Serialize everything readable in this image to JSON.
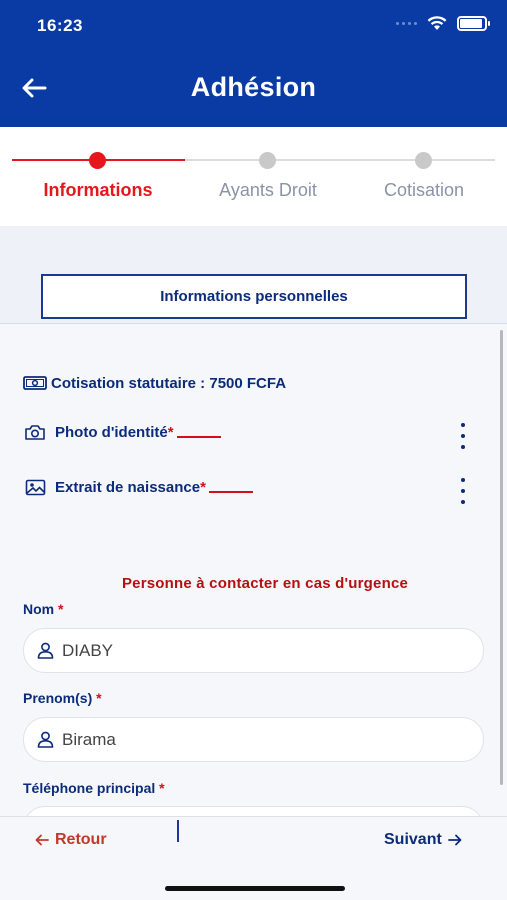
{
  "status_bar": {
    "time": "16:23"
  },
  "header": {
    "title": "Adhésion"
  },
  "stepper": {
    "steps": [
      {
        "label": "Informations",
        "state": "active"
      },
      {
        "label": "Ayants Droit",
        "state": "inactive"
      },
      {
        "label": "Cotisation",
        "state": "inactive"
      }
    ]
  },
  "section": {
    "label": "Informations personnelles"
  },
  "cotisation": {
    "text": "Cotisation statutaire : 7500 FCFA"
  },
  "documents": [
    {
      "label": "Photo d'identité",
      "required_mark": "*"
    },
    {
      "label": "Extrait de naissance",
      "required_mark": "*"
    }
  ],
  "urgence_title": "Personne à contacter en cas d'urgence",
  "fields": [
    {
      "label": "Nom",
      "required_mark": "*",
      "value": "DIABY"
    },
    {
      "label": "Prenom(s)",
      "required_mark": "*",
      "value": "Birama"
    },
    {
      "label": "Téléphone principal",
      "required_mark": "*",
      "value": ""
    }
  ],
  "footer": {
    "back_label": "Retour",
    "next_label": "Suivant"
  },
  "colors": {
    "primary": "#0a3aa3",
    "accent": "#e5171c",
    "text": "#0c2c7a",
    "inactive": "#c9c9c9"
  }
}
